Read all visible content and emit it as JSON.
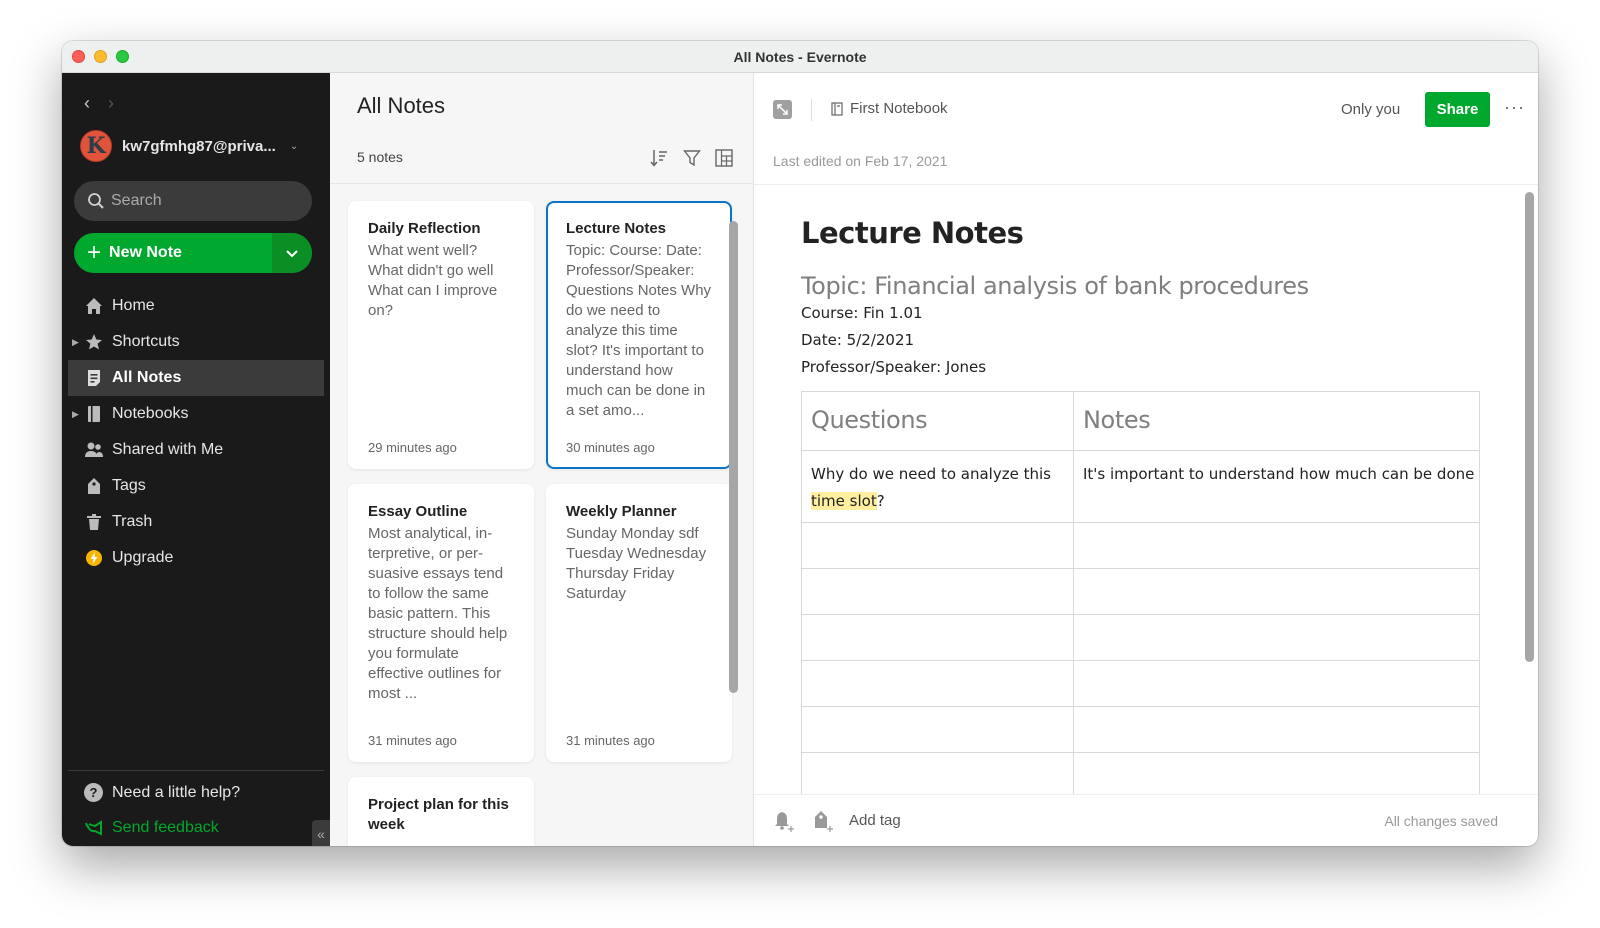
{
  "window": {
    "title": "All Notes - Evernote"
  },
  "sidebar": {
    "account_name": "kw7gfmhg87@priva...",
    "avatar_letter": "K",
    "search_placeholder": "Search",
    "new_note_label": "New Note",
    "items": [
      {
        "label": "Home",
        "icon": "home-icon",
        "expandable": false,
        "active": false
      },
      {
        "label": "Shortcuts",
        "icon": "star-icon",
        "expandable": true,
        "active": false
      },
      {
        "label": "All Notes",
        "icon": "notes-icon",
        "expandable": false,
        "active": true
      },
      {
        "label": "Notebooks",
        "icon": "notebook-icon",
        "expandable": true,
        "active": false
      },
      {
        "label": "Shared with Me",
        "icon": "people-icon",
        "expandable": false,
        "active": false
      },
      {
        "label": "Tags",
        "icon": "tag-icon",
        "expandable": false,
        "active": false
      },
      {
        "label": "Trash",
        "icon": "trash-icon",
        "expandable": false,
        "active": false
      },
      {
        "label": "Upgrade",
        "icon": "upgrade-icon",
        "expandable": false,
        "active": false
      }
    ],
    "help_label": "Need a little help?",
    "feedback_label": "Send feedback",
    "collapse_glyph": "«"
  },
  "notelist": {
    "title": "All Notes",
    "count": "5 notes",
    "notes": [
      {
        "title": "Daily Reflection",
        "snippet": "What went well? What didn't go well What can I improve on?",
        "time": "29 minutes ago",
        "selected": false
      },
      {
        "title": "Lecture Notes",
        "snippet": "Topic: Course: Date: Professor/Speaker: Questions Notes Why do we need to analyze this time slot? It's important to understand how much can be done in a set amo...",
        "time": "30 minutes ago",
        "selected": true
      },
      {
        "title": "Essay Outline",
        "snippet": "Most analytical, in-terpretive, or per-suasive essays tend to follow the same basic pattern. This structure should help you formulate effective outlines for most ...",
        "time": "31 minutes ago",
        "selected": false
      },
      {
        "title": "Weekly Planner",
        "snippet": "Sunday Monday sdf Tuesday Wednesday Thursday Friday Saturday",
        "time": "31 minutes ago",
        "selected": false
      },
      {
        "title": "Project plan for this week",
        "snippet": "",
        "time": "",
        "selected": false
      }
    ]
  },
  "editor": {
    "notebook": "First Notebook",
    "last_edited": "Last edited on Feb 17, 2021",
    "sharing": "Only you",
    "share_label": "Share",
    "more_glyph": "···",
    "note": {
      "title": "Lecture Notes",
      "topic": "Topic: Financial analysis of bank procedures",
      "lines": [
        "Course: Fin 1.01",
        "Date: 5/2/2021",
        "Professor/Speaker: Jones"
      ],
      "table": {
        "headers": [
          "Questions",
          "Notes"
        ],
        "first_row": {
          "question_before": "Why do we need to analyze this ",
          "question_highlight": "time slot",
          "question_after": "?",
          "note": "It's important to understand how much can be done in"
        },
        "empty_rows": 6
      }
    },
    "add_tag_label": "Add tag",
    "save_status": "All changes saved"
  },
  "colors": {
    "accent_green": "#00a82d",
    "selection_blue": "#0b73c9",
    "highlight_yellow": "#ffef9e",
    "sidebar_bg": "#1a1a1a"
  }
}
